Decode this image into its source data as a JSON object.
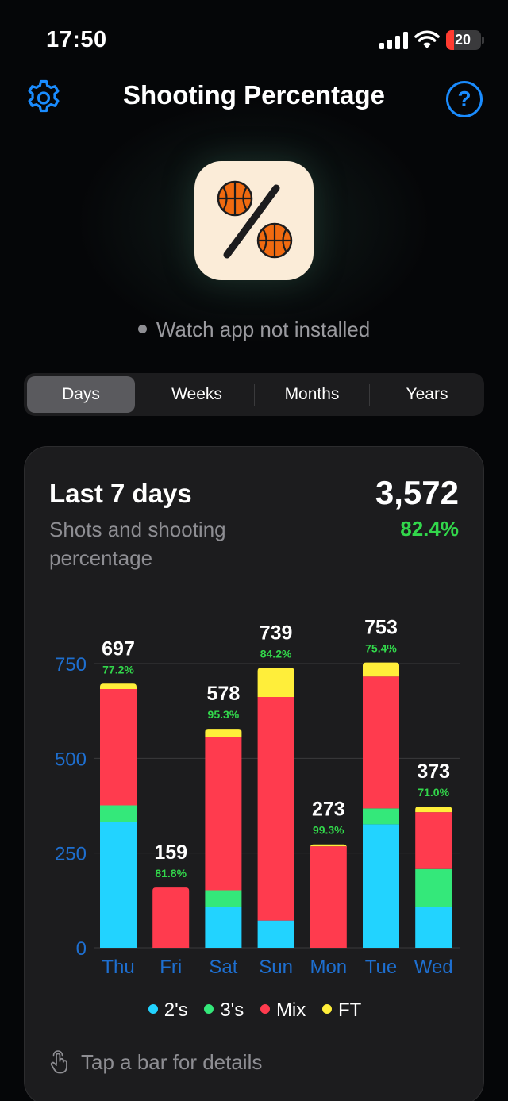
{
  "status_bar": {
    "time": "17:50",
    "battery_level": "20"
  },
  "header": {
    "title": "Shooting Percentage",
    "help_label": "?"
  },
  "watch_status": "Watch app not installed",
  "segments": [
    {
      "label": "Days",
      "selected": true
    },
    {
      "label": "Weeks",
      "selected": false
    },
    {
      "label": "Months",
      "selected": false
    },
    {
      "label": "Years",
      "selected": false
    }
  ],
  "card": {
    "title": "Last 7 days",
    "subtitle": "Shots and shooting percentage",
    "total": "3,572",
    "percentage": "82.4%"
  },
  "legend": [
    {
      "label": "2's",
      "color": "#22d3ff"
    },
    {
      "label": "3's",
      "color": "#34e87a"
    },
    {
      "label": "Mix",
      "color": "#ff3b4e"
    },
    {
      "label": "FT",
      "color": "#ffee3a"
    }
  ],
  "hint": "Tap a bar for details",
  "colors": {
    "accent": "#1a8cff",
    "grid_label": "#1e6fd0",
    "percent": "#32d74b"
  },
  "chart_data": {
    "type": "bar",
    "stacked": true,
    "categories": [
      "Thu",
      "Fri",
      "Sat",
      "Sun",
      "Mon",
      "Tue",
      "Wed"
    ],
    "ylim": [
      0,
      750
    ],
    "yticks": [
      0,
      250,
      500,
      750
    ],
    "totals": [
      "697",
      "159",
      "578",
      "739",
      "273",
      "753",
      "373"
    ],
    "percentages": [
      "77.2%",
      "81.8%",
      "95.3%",
      "84.2%",
      "99.3%",
      "75.4%",
      "71.0%"
    ],
    "series": [
      {
        "name": "2's",
        "color": "#22d3ff",
        "values": [
          332,
          0,
          108,
          72,
          0,
          326,
          108
        ]
      },
      {
        "name": "3's",
        "color": "#34e87a",
        "values": [
          44,
          0,
          44,
          0,
          0,
          42,
          100
        ]
      },
      {
        "name": "Mix",
        "color": "#ff3b4e",
        "values": [
          307,
          159,
          404,
          590,
          268,
          348,
          150
        ]
      },
      {
        "name": "FT",
        "color": "#ffee3a",
        "values": [
          14,
          0,
          22,
          77,
          5,
          37,
          15
        ]
      }
    ]
  }
}
